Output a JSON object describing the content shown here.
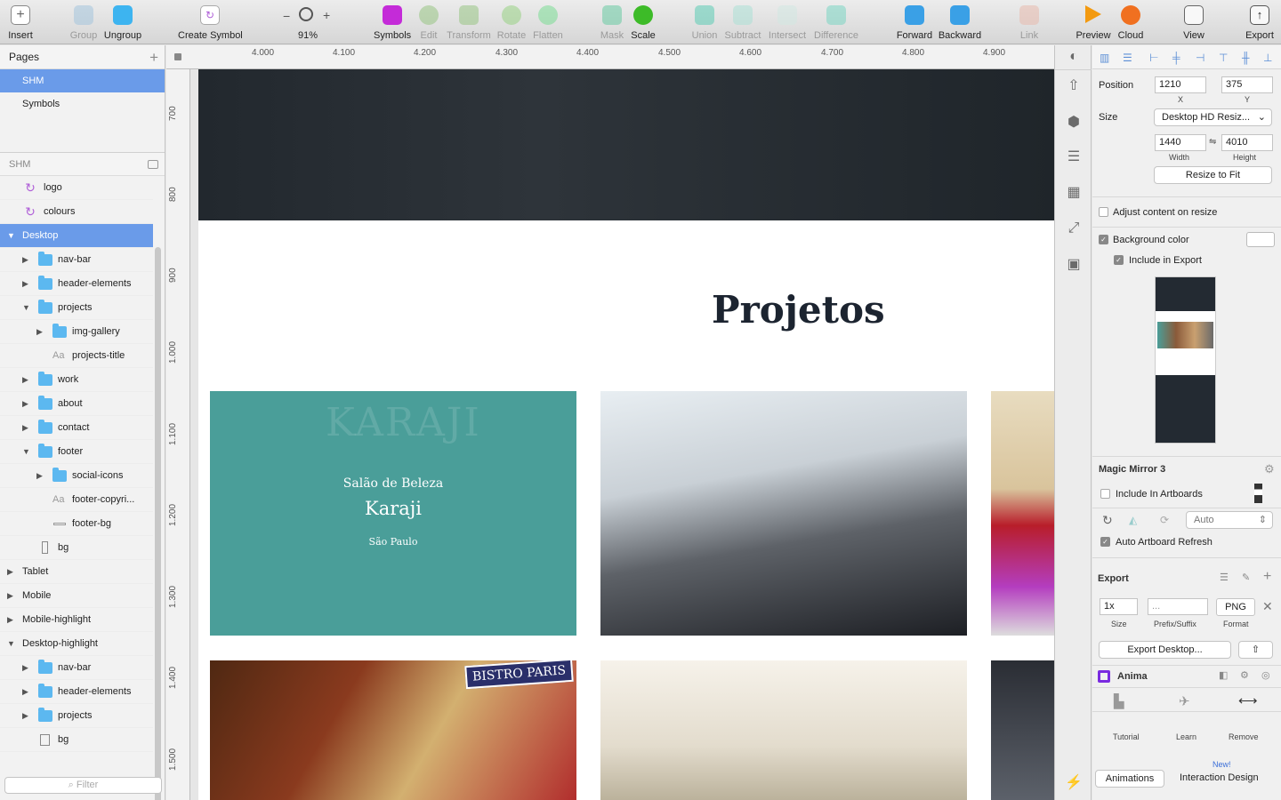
{
  "toolbar": {
    "insert": "Insert",
    "group": "Group",
    "ungroup": "Ungroup",
    "create_symbol": "Create Symbol",
    "zoom_minus": "−",
    "zoom_plus": "+",
    "zoom": "91%",
    "symbols": "Symbols",
    "edit": "Edit",
    "transform": "Transform",
    "rotate": "Rotate",
    "flatten": "Flatten",
    "mask": "Mask",
    "scale": "Scale",
    "union": "Union",
    "subtract": "Subtract",
    "intersect": "Intersect",
    "difference": "Difference",
    "forward": "Forward",
    "backward": "Backward",
    "link": "Link",
    "preview": "Preview",
    "cloud": "Cloud",
    "view": "View",
    "export": "Export"
  },
  "pages": {
    "header": "Pages",
    "add": "+",
    "items": [
      {
        "label": "SHM"
      },
      {
        "label": "Symbols"
      }
    ]
  },
  "layers": {
    "header": "SHM",
    "items": [
      {
        "label": "logo"
      },
      {
        "label": "colours"
      },
      {
        "label": "Desktop"
      },
      {
        "label": "nav-bar"
      },
      {
        "label": "header-elements"
      },
      {
        "label": "projects"
      },
      {
        "label": "img-gallery"
      },
      {
        "label": "projects-title"
      },
      {
        "label": "work"
      },
      {
        "label": "about"
      },
      {
        "label": "contact"
      },
      {
        "label": "footer"
      },
      {
        "label": "social-icons"
      },
      {
        "label": "footer-copyri..."
      },
      {
        "label": "footer-bg"
      },
      {
        "label": "bg"
      },
      {
        "label": "Tablet"
      },
      {
        "label": "Mobile"
      },
      {
        "label": "Mobile-highlight"
      },
      {
        "label": "Desktop-highlight"
      },
      {
        "label": "nav-bar"
      },
      {
        "label": "header-elements"
      },
      {
        "label": "projects"
      },
      {
        "label": "bg"
      }
    ],
    "filter_placeholder": "Filter"
  },
  "ruler": {
    "top": [
      "4.000",
      "4.100",
      "4.200",
      "4.300",
      "4.400",
      "4.500",
      "4.600",
      "4.700",
      "4.800",
      "4.900"
    ],
    "left": [
      "700",
      "800",
      "900",
      "1.000",
      "1.100",
      "1.200",
      "1.300",
      "1.400",
      "1.500"
    ]
  },
  "artboard": {
    "section_title": "Projetos",
    "card1": {
      "logo_text": "KARAJI",
      "subtitle": "Salão de Beleza",
      "title": "Karaji",
      "city": "São Paulo"
    },
    "card4": {
      "sign": "BISTRO PARIS"
    }
  },
  "inspector": {
    "position_label": "Position",
    "x": "1210",
    "y": "375",
    "x_label": "X",
    "y_label": "Y",
    "size_label": "Size",
    "size_preset": "Desktop HD Resiz...",
    "width": "1440",
    "height": "4010",
    "width_label": "Width",
    "height_label": "Height",
    "resize_to_fit": "Resize to Fit",
    "adjust_content": "Adjust content on resize",
    "background_color": "Background color",
    "include_in_export": "Include in Export",
    "magic_mirror": "Magic Mirror 3",
    "include_in_artboards": "Include In Artboards",
    "auto_select": "Auto",
    "auto_refresh": "Auto Artboard Refresh",
    "export_header": "Export",
    "export_scale": "1x",
    "export_prefix": "...",
    "export_format": "PNG",
    "export_size_label": "Size",
    "export_prefix_label": "Prefix/Suffix",
    "export_format_label": "Format",
    "export_button": "Export Desktop...",
    "anima": "Anima",
    "tutorial": "Tutorial",
    "learn": "Learn",
    "remove": "Remove",
    "animations": "Animations",
    "new_badge": "New!",
    "interaction_design": "Interaction Design"
  },
  "colors": {
    "accent": "#6a9be9",
    "symbol": "#b060d8",
    "folder": "#5cb8f0",
    "card_teal": "#4a9e99",
    "title": "#1c2430"
  }
}
